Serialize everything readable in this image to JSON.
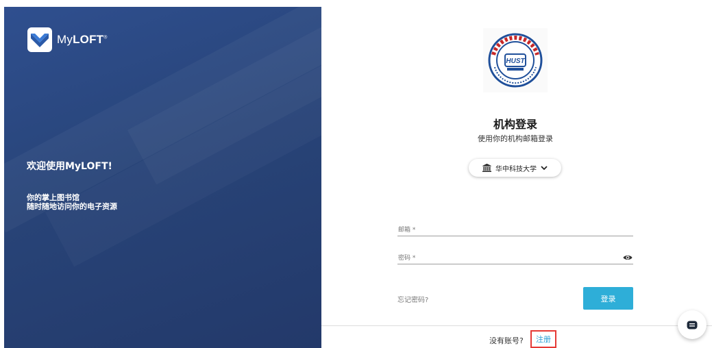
{
  "brand": {
    "name_prefix": "My",
    "name_suffix": "LOFT",
    "trademark": "®"
  },
  "left_panel": {
    "welcome": "欢迎使用MyLOFT!",
    "tagline_line1": "你的掌上图书馆",
    "tagline_line2": "随时随地访问你的电子资源"
  },
  "institution_logo": {
    "icon": "university-seal-icon",
    "seal_text": "HUST",
    "seal_ring_text": "UNIVERSITY OF SCIENCE AND TECHNOLOGY"
  },
  "login": {
    "title": "机构登录",
    "subtitle": "使用你的机构邮箱登录",
    "institution_select": {
      "icon": "institution-icon",
      "value": "华中科技大学",
      "chevron": "chevron-down-icon"
    },
    "email_placeholder": "邮箱 *",
    "password_placeholder": "密码 *",
    "password_toggle_icon": "eye-icon",
    "forgot_password": "忘记密码?",
    "submit_label": "登录"
  },
  "footer": {
    "no_account": "没有账号?",
    "register_label": "注册"
  },
  "chat": {
    "icon": "chat-icon"
  },
  "colors": {
    "panel_bg": "#2a4478",
    "accent": "#2eaed8",
    "link": "#2b9fd6",
    "highlight": "#e53935"
  }
}
